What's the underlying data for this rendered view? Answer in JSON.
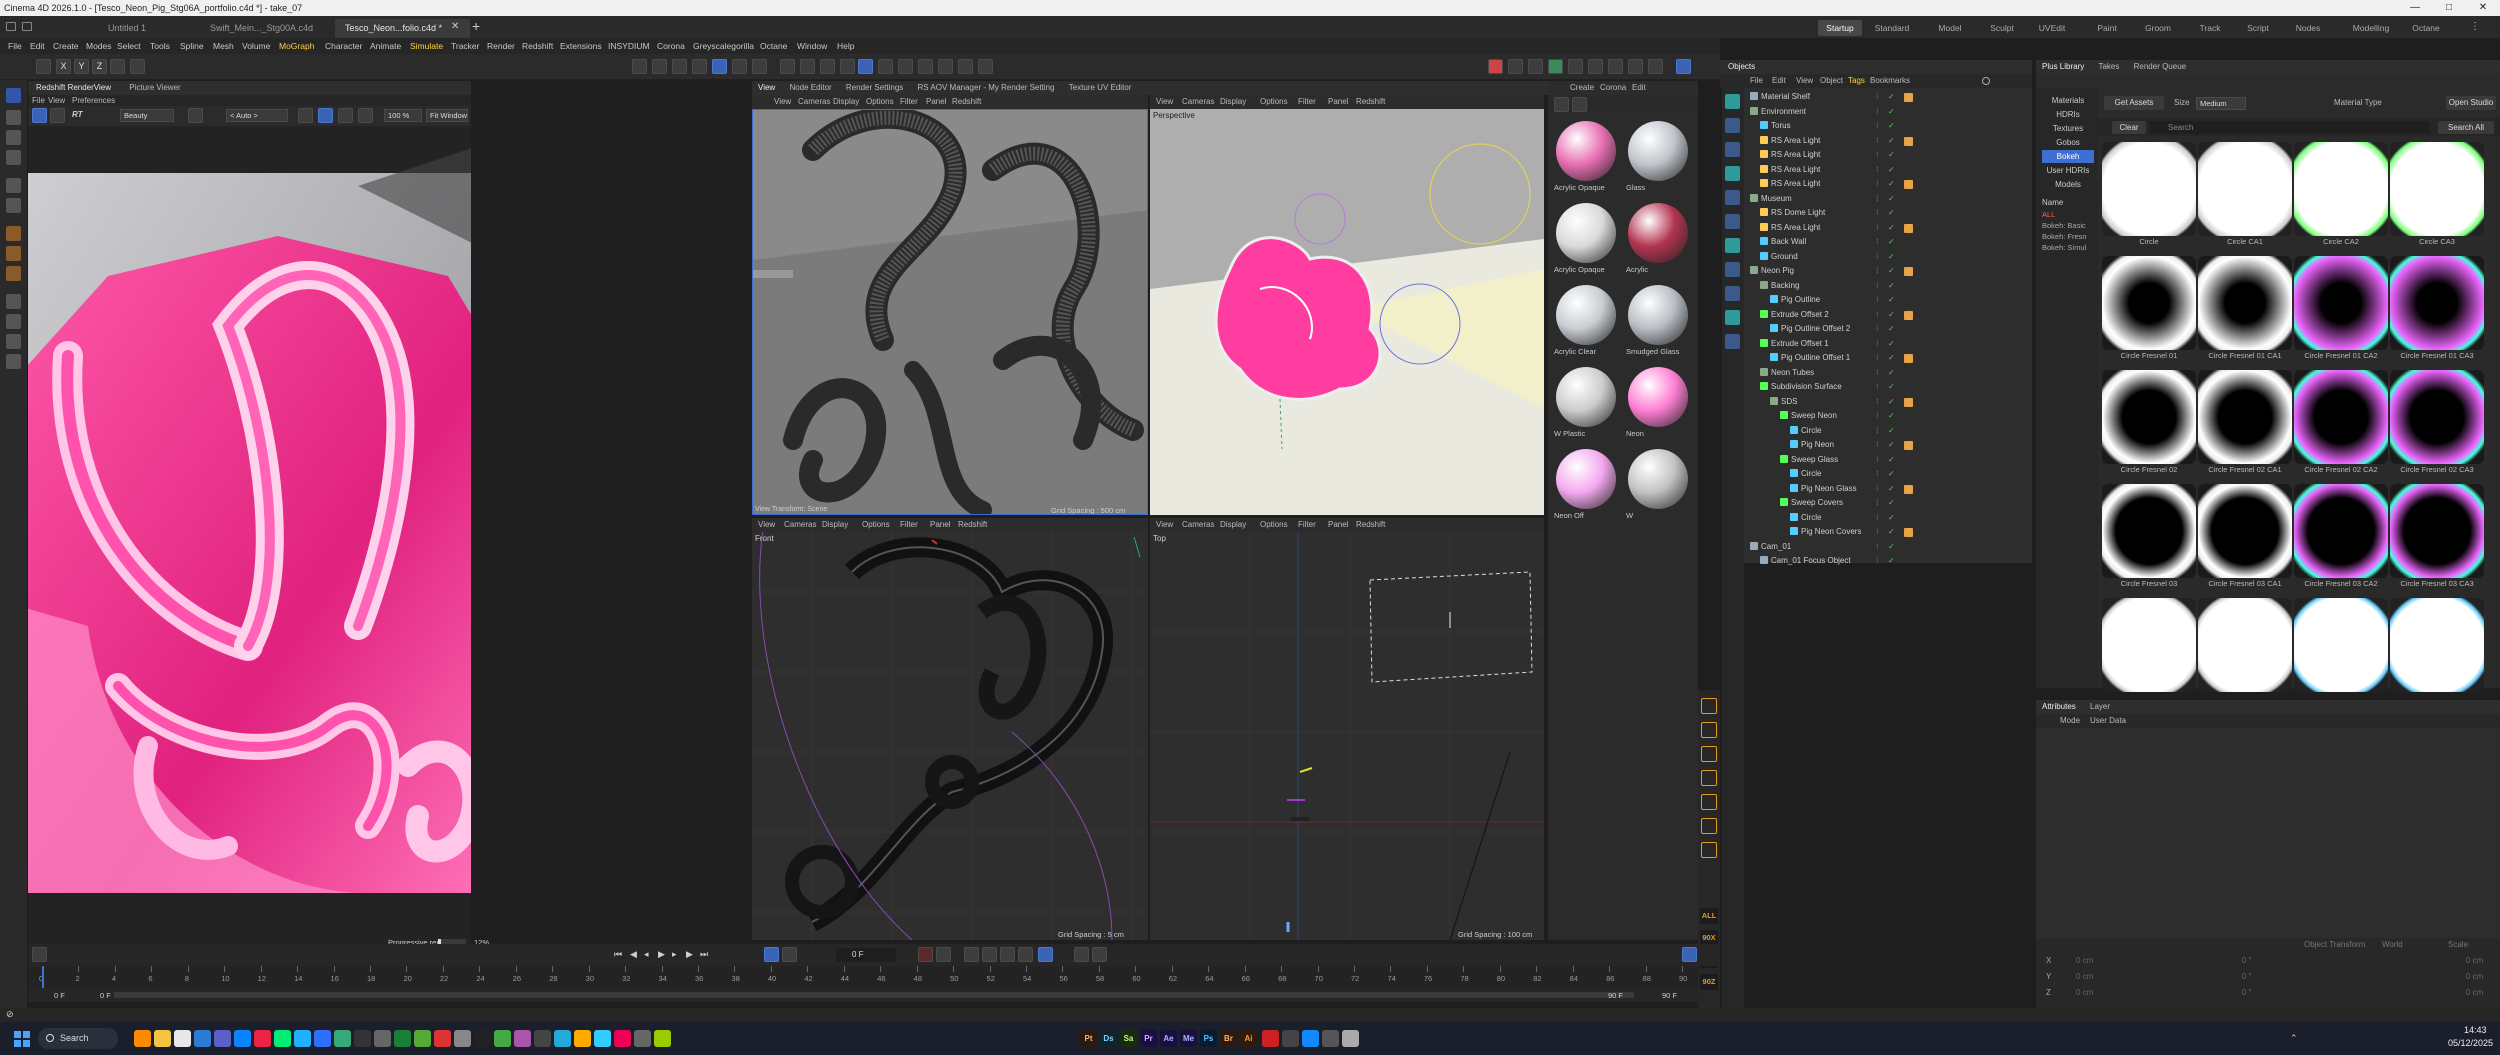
{
  "window": {
    "title": "Cinema 4D 2026.1.0 - [Tesco_Neon_Pig_Stg06A_portfolio.c4d *] - take_07",
    "controls": [
      "—",
      "□",
      "✕"
    ]
  },
  "doc_tabs": [
    "Untitled 1",
    "Swift_Mein..._Stg00A.c4d",
    "Tesco_Neon...folio.c4d *"
  ],
  "layout_tabs": [
    "Startup",
    "Standard",
    "Model",
    "Sculpt",
    "UVEdit",
    "Paint",
    "Groom",
    "Track",
    "Script",
    "Nodes",
    "Modelling",
    "Octane"
  ],
  "menu": [
    "File",
    "Edit",
    "Create",
    "Modes",
    "Select",
    "Tools",
    "Spline",
    "Mesh",
    "Volume",
    "MoGraph",
    "Character",
    "Animate",
    "Simulate",
    "Tracker",
    "Render",
    "Redshift",
    "Extensions",
    "INSYDIUM",
    "Corona",
    "Greyscalegorilla",
    "Octane",
    "Window",
    "Help"
  ],
  "renderview": {
    "tabs": [
      "Redshift RenderView",
      "Picture Viewer"
    ],
    "menu": [
      "File",
      "View",
      "Preferences"
    ],
    "rt_label": "RT",
    "aov": "Beauty",
    "auto": "< Auto >",
    "zoom": "100 %",
    "fit": "Fit Window",
    "status": "Progressive rendering",
    "progress_pct": 12,
    "progress_label": "12%"
  },
  "center_tabs": [
    "View",
    "Node Editor",
    "Render Settings",
    "RS AOV Manager - My Render Setting",
    "Texture UV Editor"
  ],
  "vp_menu": [
    "View",
    "Cameras",
    "Display",
    "Options",
    "Filter",
    "Panel"
  ],
  "vp_redshift": "Redshift",
  "viewports": {
    "tl": {
      "name": "",
      "footer_left": "View Transform: Scene",
      "footer_right": "Grid Spacing : 500 cm"
    },
    "tr": {
      "name": "Perspective",
      "footer_right": ""
    },
    "bl": {
      "name": "Front",
      "footer_right": "Grid Spacing : 5 cm"
    },
    "br": {
      "name": "Top",
      "footer_right": "Grid Spacing : 100 cm"
    }
  },
  "materials": {
    "menu": [
      "Create",
      "Corona",
      "Edit"
    ],
    "items": [
      {
        "label": "Acrylic Opaque",
        "color": "#e86fb2"
      },
      {
        "label": "Glass",
        "color": "#bfc5cc"
      },
      {
        "label": "Acrylic Opaque",
        "color": "#d9d9d9"
      },
      {
        "label": "Acrylic",
        "color": "#b3344f"
      },
      {
        "label": "Acrylic Clear",
        "color": "#c8cdd2"
      },
      {
        "label": "Smudged Glass",
        "color": "#b8bec4"
      },
      {
        "label": "W Plastic",
        "color": "#cccccc"
      },
      {
        "label": "Neon",
        "color": "#ff7fd4"
      },
      {
        "label": "Neon Off",
        "color": "#f3a9ee"
      },
      {
        "label": "W",
        "color": "#c2c2c2"
      }
    ]
  },
  "objects": {
    "tabs": [
      "Objects",
      "Takes"
    ],
    "menu": [
      "File",
      "Edit",
      "View",
      "Object",
      "Tags",
      "Bookmarks"
    ],
    "rows": [
      {
        "indent": 0,
        "name": "Material Shelf",
        "color": "#9ab"
      },
      {
        "indent": 0,
        "name": "Environment",
        "color": "#8a8"
      },
      {
        "indent": 1,
        "name": "Torus",
        "color": "#5cf"
      },
      {
        "indent": 1,
        "name": "RS Area Light",
        "color": "#fc5"
      },
      {
        "indent": 1,
        "name": "RS Area Light",
        "color": "#fc5"
      },
      {
        "indent": 1,
        "name": "RS Area Light",
        "color": "#fc5"
      },
      {
        "indent": 1,
        "name": "RS Area Light",
        "color": "#fc5"
      },
      {
        "indent": 0,
        "name": "Museum",
        "color": "#8a8"
      },
      {
        "indent": 1,
        "name": "RS Dome Light",
        "color": "#fc5"
      },
      {
        "indent": 1,
        "name": "RS Area Light",
        "color": "#fc5"
      },
      {
        "indent": 1,
        "name": "Back Wall",
        "color": "#5cf"
      },
      {
        "indent": 1,
        "name": "Ground",
        "color": "#5cf"
      },
      {
        "indent": 0,
        "name": "Neon Pig",
        "color": "#8a8"
      },
      {
        "indent": 1,
        "name": "Backing",
        "color": "#8a8"
      },
      {
        "indent": 2,
        "name": "Pig Outline",
        "color": "#5cf"
      },
      {
        "indent": 1,
        "name": "Extrude Offset 2",
        "color": "#5f5"
      },
      {
        "indent": 2,
        "name": "Pig Outline Offset 2",
        "color": "#5cf"
      },
      {
        "indent": 1,
        "name": "Extrude Offset 1",
        "color": "#5f5"
      },
      {
        "indent": 2,
        "name": "Pig Outline Offset 1",
        "color": "#5cf"
      },
      {
        "indent": 1,
        "name": "Neon Tubes",
        "color": "#8a8"
      },
      {
        "indent": 1,
        "name": "Subdivision Surface",
        "color": "#5f5"
      },
      {
        "indent": 2,
        "name": "SDS",
        "color": "#8a8"
      },
      {
        "indent": 3,
        "name": "Sweep Neon",
        "color": "#5f5"
      },
      {
        "indent": 4,
        "name": "Circle",
        "color": "#5cf"
      },
      {
        "indent": 4,
        "name": "Pig Neon",
        "color": "#5cf"
      },
      {
        "indent": 3,
        "name": "Sweep Glass",
        "color": "#5f5"
      },
      {
        "indent": 4,
        "name": "Circle",
        "color": "#5cf"
      },
      {
        "indent": 4,
        "name": "Pig Neon Glass",
        "color": "#5cf"
      },
      {
        "indent": 3,
        "name": "Sweep Covers",
        "color": "#5f5"
      },
      {
        "indent": 4,
        "name": "Circle",
        "color": "#5cf"
      },
      {
        "indent": 4,
        "name": "Pig Neon Covers",
        "color": "#5cf"
      },
      {
        "indent": 0,
        "name": "Cam_01",
        "color": "#9ab"
      },
      {
        "indent": 1,
        "name": "Cam_01 Focus Object",
        "color": "#9ab"
      }
    ]
  },
  "plus_library": {
    "tabs": [
      "Plus Library",
      "Takes",
      "Render Queue"
    ],
    "get_assets": "Get Assets",
    "size_label": "Size",
    "size_value": "Medium",
    "material_type": "Material Type",
    "open_studio": "Open Studio",
    "clear": "Clear",
    "search": "Search",
    "search_all": "Search All",
    "categories": [
      "Materials",
      "HDRIs",
      "Textures",
      "Gobos",
      "Bokeh",
      "User HDRIs",
      "Models"
    ],
    "active_category": "Bokeh",
    "name_header": "Name",
    "name_filters": [
      "ALL",
      "Bokeh: Basic",
      "Bokeh: Fresn",
      "Bokeh: Simul"
    ],
    "assets": [
      "Circle",
      "Circle CA1",
      "Circle CA2",
      "Circle CA3",
      "Circle Fresnel 01",
      "Circle Fresnel 01 CA1",
      "Circle Fresnel 01 CA2",
      "Circle Fresnel 01 CA3",
      "Circle Fresnel 02",
      "Circle Fresnel 02 CA1",
      "Circle Fresnel 02 CA2",
      "Circle Fresnel 02 CA3",
      "Circle Fresnel 03",
      "Circle Fresnel 03 CA1",
      "Circle Fresnel 03 CA2",
      "Circle Fresnel 03 CA3",
      "",
      "",
      "",
      ""
    ]
  },
  "attributes": {
    "tabs": [
      "Attributes",
      "Layer"
    ],
    "mode": "Mode",
    "user_data": "User Data",
    "coords": [
      {
        "axis": "X",
        "a": "0 cm",
        "b": "0 °",
        "c": "0 cm"
      },
      {
        "axis": "Y",
        "a": "0 cm",
        "b": "0 °",
        "c": "0 cm"
      },
      {
        "axis": "Z",
        "a": "0 cm",
        "b": "0 °",
        "c": "0 cm"
      }
    ],
    "transform_label": "Object Transform",
    "world_label": "World",
    "scale_label": "Scale"
  },
  "timeline": {
    "current_frame": "0 F",
    "start": "0 F",
    "start2": "0 F",
    "end": "90 F",
    "end2": "90 F",
    "ticks": [
      "0",
      "2",
      "4",
      "6",
      "8",
      "10",
      "12",
      "14",
      "16",
      "18",
      "20",
      "22",
      "24",
      "26",
      "28",
      "30",
      "32",
      "34",
      "36",
      "38",
      "40",
      "42",
      "44",
      "46",
      "48",
      "50",
      "52",
      "54",
      "56",
      "58",
      "60",
      "62",
      "64",
      "66",
      "68",
      "70",
      "72",
      "74",
      "76",
      "78",
      "80",
      "82",
      "84",
      "86",
      "88",
      "90"
    ]
  },
  "side_panel_labels": [
    "LT",
    "S",
    "ALL",
    "90X",
    "90Y",
    "90Z"
  ],
  "taskbar": {
    "search": "Search",
    "apps": [
      "Pt",
      "Ds",
      "Sa",
      "Pr",
      "Ae",
      "Me",
      "Ps",
      "Br",
      "Ai"
    ],
    "time": "14:43",
    "date": "05/12/2025"
  }
}
